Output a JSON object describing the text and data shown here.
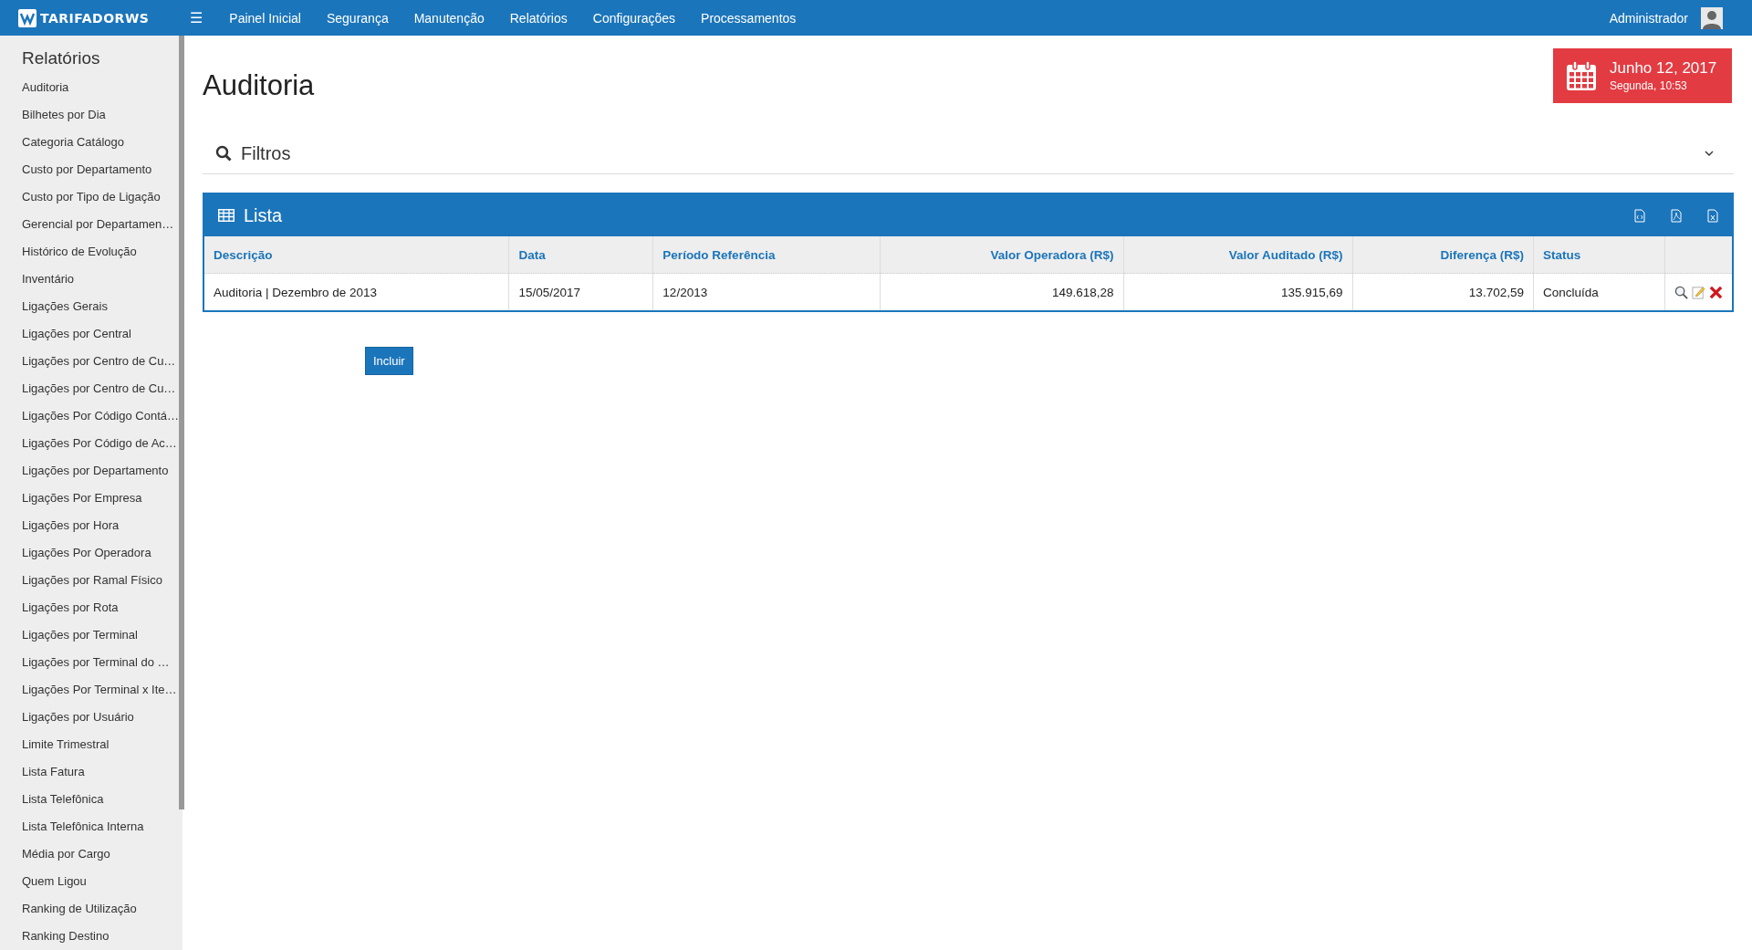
{
  "topbar": {
    "logo": "TARIFADORWS",
    "menu_icon": "☰",
    "nav": [
      "Painel Inicial",
      "Segurança",
      "Manutenção",
      "Relatórios",
      "Configurações",
      "Processamentos"
    ],
    "user": "Administrador"
  },
  "sidebar": {
    "title": "Relatórios",
    "items": [
      "Auditoria",
      "Bilhetes por Dia",
      "Categoria Catálogo",
      "Custo por Departamento",
      "Custo por Tipo de Ligação",
      "Gerencial por Departamen…",
      "Histórico de Evolução",
      "Inventário",
      "Ligações Gerais",
      "Ligações por Central",
      "Ligações por Centro de Cu…",
      "Ligações por Centro de Cu…",
      "Ligações Por Código Contá…",
      "Ligações Por Código de Ac…",
      "Ligações por Departamento",
      "Ligações Por Empresa",
      "Ligações por Hora",
      "Ligações Por Operadora",
      "Ligações por Ramal Físico",
      "Ligações por Rota",
      "Ligações por Terminal",
      "Ligações por Terminal do …",
      "Ligações Por Terminal x Ite…",
      "Ligações por Usuário",
      "Limite Trimestral",
      "Lista Fatura",
      "Lista Telefônica",
      "Lista Telefônica Interna",
      "Média por Cargo",
      "Quem Ligou",
      "Ranking de Utilização",
      "Ranking Destino"
    ]
  },
  "page_title": "Auditoria",
  "date_box": {
    "date": "Junho 12, 2017",
    "day_time": "Segunda, 10:53"
  },
  "filters": {
    "title": "Filtros",
    "expanded": false
  },
  "list": {
    "title": "Lista",
    "columns": [
      "Descrição",
      "Data",
      "Período Referência",
      "Valor Operadora (R$)",
      "Valor Auditado (R$)",
      "Diferença (R$)",
      "Status"
    ],
    "rows": [
      {
        "cells": [
          "Auditoria | Dezembro de 2013",
          "15/05/2017",
          "12/2013",
          "149.618,28",
          "135.915,69",
          "13.702,59",
          "Concluída"
        ]
      }
    ]
  },
  "add_button": "Incluir"
}
